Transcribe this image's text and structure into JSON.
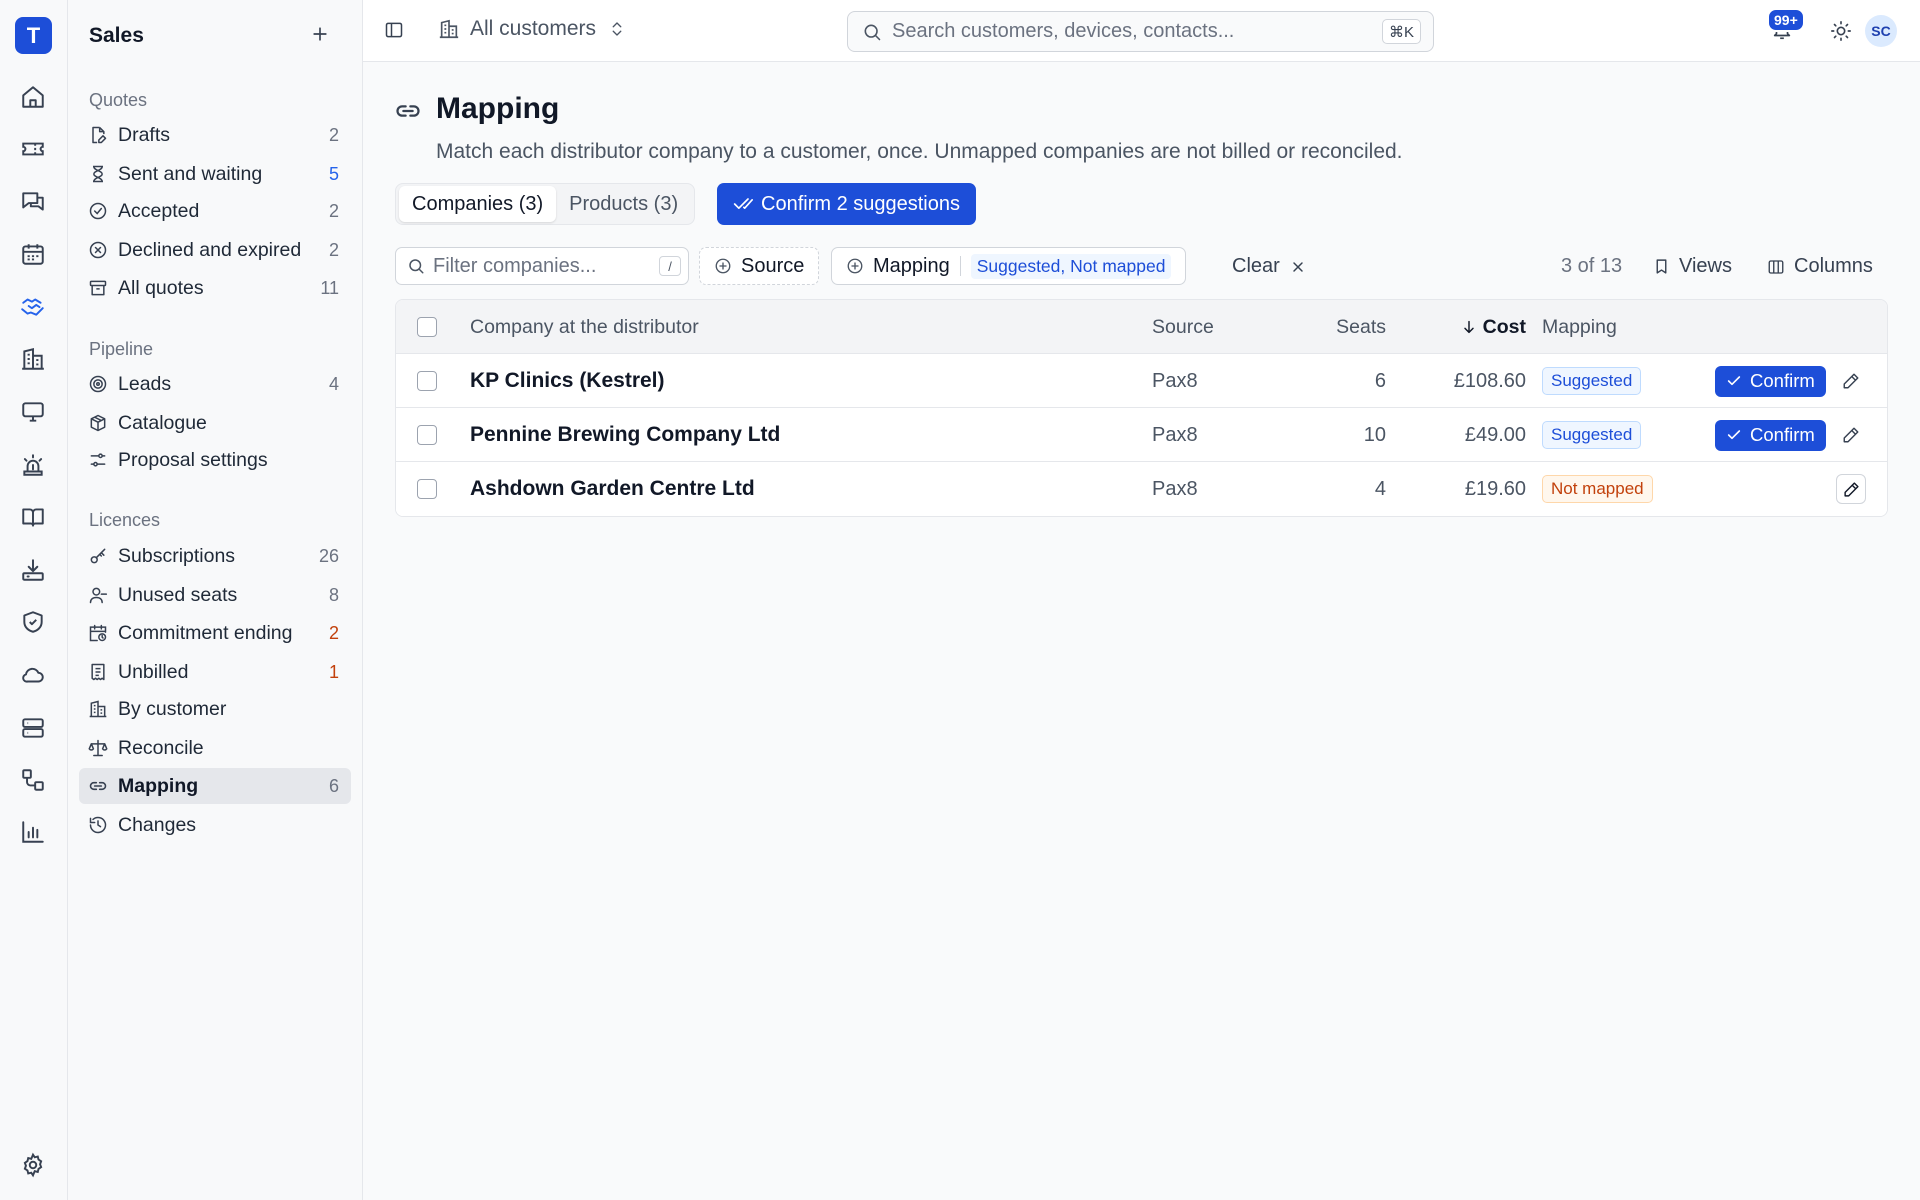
{
  "app": {
    "logo_letter": "T"
  },
  "sidebar": {
    "title": "Sales",
    "groups": [
      {
        "label": "Quotes"
      },
      {
        "label": "Pipeline"
      },
      {
        "label": "Licences"
      }
    ],
    "items": [
      {
        "label": "Drafts",
        "count": "2"
      },
      {
        "label": "Sent and waiting",
        "count": "5"
      },
      {
        "label": "Accepted",
        "count": "2"
      },
      {
        "label": "Declined and expired",
        "count": "2"
      },
      {
        "label": "All quotes",
        "count": "11"
      },
      {
        "label": "Leads",
        "count": "4"
      },
      {
        "label": "Catalogue"
      },
      {
        "label": "Proposal settings"
      },
      {
        "label": "Subscriptions",
        "count": "26"
      },
      {
        "label": "Unused seats",
        "count": "8"
      },
      {
        "label": "Commitment ending",
        "count": "2"
      },
      {
        "label": "Unbilled",
        "count": "1"
      },
      {
        "label": "By customer"
      },
      {
        "label": "Reconcile"
      },
      {
        "label": "Mapping",
        "count": "6"
      },
      {
        "label": "Changes"
      }
    ]
  },
  "topbar": {
    "scope_label": "All customers",
    "search_placeholder": "Search customers, devices, contacts...",
    "search_shortcut": "⌘K",
    "notifications_badge": "99+",
    "avatar_initials": "SC"
  },
  "page": {
    "title": "Mapping",
    "subtitle": "Match each distributor company to a customer, once. Unmapped companies are not billed or reconciled.",
    "tabs": [
      {
        "label": "Companies (3)"
      },
      {
        "label": "Products (3)"
      }
    ],
    "confirm_all_label": "Confirm 2 suggestions"
  },
  "filters": {
    "filter_placeholder": "Filter companies...",
    "filter_shortcut": "/",
    "source_label": "Source",
    "mapping_label": "Mapping",
    "mapping_values": "Suggested, Not mapped",
    "clear_label": "Clear",
    "count_text": "3 of 13",
    "views_label": "Views",
    "columns_label": "Columns"
  },
  "table": {
    "headers": {
      "company": "Company at the distributor",
      "source": "Source",
      "seats": "Seats",
      "cost": "Cost",
      "mapping": "Mapping"
    },
    "rows": [
      {
        "company": "KP Clinics (Kestrel)",
        "source": "Pax8",
        "seats": "6",
        "cost": "£108.60",
        "mapping": "Suggested",
        "confirm": "Confirm"
      },
      {
        "company": "Pennine Brewing Company Ltd",
        "source": "Pax8",
        "seats": "10",
        "cost": "£49.00",
        "mapping": "Suggested",
        "confirm": "Confirm"
      },
      {
        "company": "Ashdown Garden Centre Ltd",
        "source": "Pax8",
        "seats": "4",
        "cost": "£19.60",
        "mapping": "Not mapped"
      }
    ]
  },
  "colors": {
    "accent": "#1d4ed8",
    "warning": "#c2410c"
  }
}
